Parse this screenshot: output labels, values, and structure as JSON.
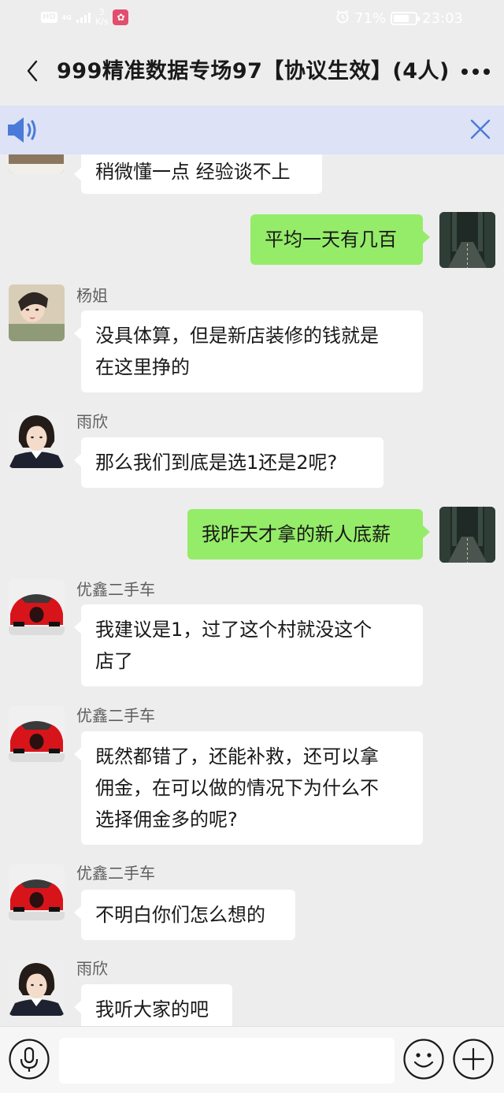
{
  "status_bar": {
    "hd": "HD",
    "network": "4G",
    "speed_value": "3",
    "speed_unit": "K/s",
    "battery": "71%",
    "time": "23:03",
    "icons": [
      "signal-icon",
      "paw-app-icon",
      "alarm-icon",
      "battery-icon"
    ]
  },
  "header": {
    "title": "999精准数据专场97【协议生效】(4人)",
    "icons": [
      "back-icon",
      "more-icon"
    ]
  },
  "banner": {
    "icons": [
      "speaker-icon",
      "close-icon"
    ]
  },
  "messages": [
    {
      "side": "in",
      "text": "稍微懂一点 经验谈不上"
    },
    {
      "side": "out",
      "text": "平均一天有几百"
    },
    {
      "side": "in",
      "sender": "杨姐",
      "line1": "没具体算，但是新店装修的钱就是",
      "line2": "在这里挣的"
    },
    {
      "side": "in",
      "sender": "雨欣",
      "text": "那么我们到底是选1还是2呢?"
    },
    {
      "side": "out",
      "text": "我昨天才拿的新人底薪"
    },
    {
      "side": "in",
      "sender": "优鑫二手车",
      "line1": "我建议是1，过了这个村就没这个",
      "line2": "店了"
    },
    {
      "side": "in",
      "sender": "优鑫二手车",
      "line1": "既然都错了，还能补救，还可以拿",
      "line2": "佣金，在可以做的情况下为什么不",
      "line3": "选择佣金多的呢?"
    },
    {
      "side": "in",
      "sender": "优鑫二手车",
      "text": "不明白你们怎么想的"
    },
    {
      "side": "in",
      "sender": "雨欣",
      "text": "我听大家的吧"
    }
  ],
  "input_bar": {
    "placeholder": "",
    "icons": [
      "microphone-icon",
      "emoji-icon",
      "plus-icon"
    ]
  },
  "colors": {
    "background": "#ededed",
    "incoming_bubble": "#ffffff",
    "outgoing_bubble": "#95ec69",
    "banner": "#dde2f6",
    "accent_blue": "#4a7bd8"
  }
}
